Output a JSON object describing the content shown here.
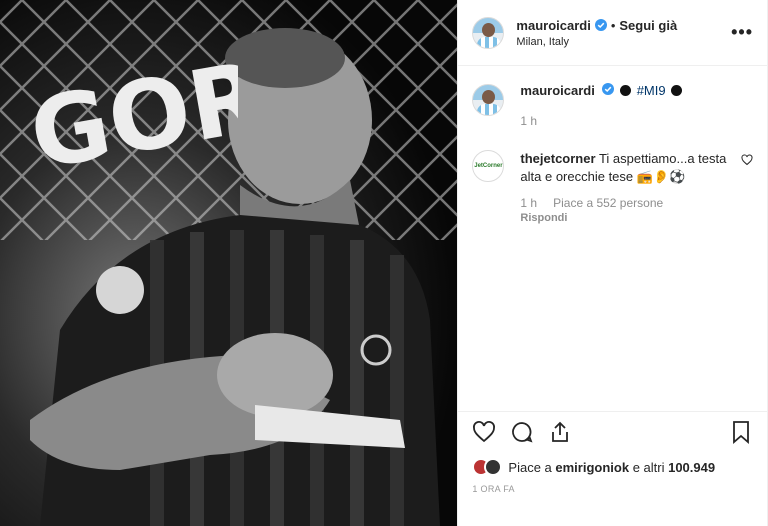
{
  "post": {
    "photo_alt": "Black and white photo of a footballer",
    "sign_text": "GORI"
  },
  "header": {
    "username": "mauroicardi",
    "separator": "•",
    "follow_label": "Segui già",
    "location": "Milan, Italy",
    "more_label": "•••"
  },
  "caption": {
    "username": "mauroicardi",
    "hashtag": "#MI9",
    "time": "1 h"
  },
  "comments": [
    {
      "username": "thejetcorner",
      "text": "Ti aspettiamo...a testa alta e orecchie tese 📻👂⚽",
      "time": "1 h",
      "likes": "Piace a 552 persone",
      "reply_label": "Rispondi",
      "avatar_text": "JetCorner"
    }
  ],
  "likes": {
    "prefix": "Piace a ",
    "user": "emirigoniok",
    "middle": " e altri ",
    "count": "100.949"
  },
  "timestamp": "1 ORA FA",
  "colors": {
    "verified": "#3897f0",
    "text": "#262626",
    "muted": "#8e8e8e"
  }
}
